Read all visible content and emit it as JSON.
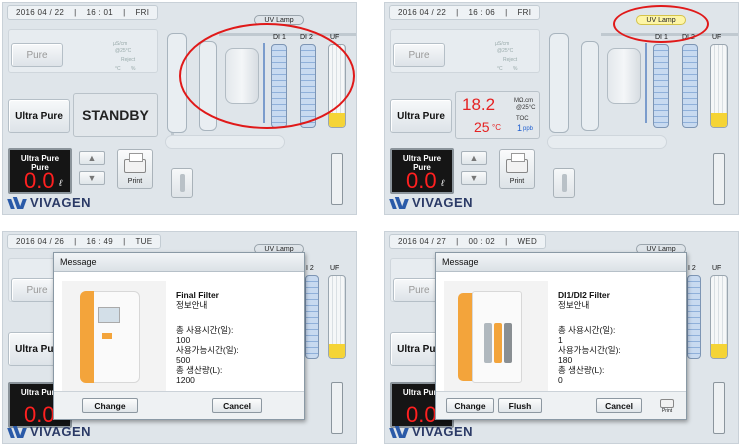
{
  "screens": [
    {
      "datebar": {
        "date": "2016  04 / 22",
        "time": "16 : 01",
        "day": "FRI"
      },
      "pure_label": "Pure",
      "pure_units": [
        "µS/cm",
        "@25°C",
        "Reject",
        "°C",
        "%"
      ],
      "ultra_pure_label": "Ultra Pure",
      "status_text": "STANDBY",
      "counter": {
        "label1": "Ultra Pure",
        "label2": "Pure",
        "value": "0.0",
        "unit": "ℓ"
      },
      "print_label": "Print",
      "uv_lamp_label": "UV Lamp",
      "columns": {
        "di1": "DI 1",
        "di2": "DI 2",
        "uf": "UF"
      },
      "uv_lamp_on": false,
      "logo": "VIVAGEN"
    },
    {
      "datebar": {
        "date": "2016  04 / 22",
        "time": "16 : 06",
        "day": "FRI"
      },
      "pure_label": "Pure",
      "pure_units": [
        "µS/cm",
        "@25°C",
        "Reject",
        "°C",
        "%"
      ],
      "ultra_pure_label": "Ultra Pure",
      "reading": {
        "resistivity": "18.2",
        "resistivity_unit_top": "MΩ.cm",
        "resistivity_unit_bottom": "@25°C",
        "temperature": "25",
        "temperature_unit": "°C",
        "toc_label": "TOC",
        "toc_value": "1",
        "toc_unit": "ppb"
      },
      "counter": {
        "label1": "Ultra Pure",
        "label2": "Pure",
        "value": "0.0",
        "unit": "ℓ"
      },
      "print_label": "Print",
      "uv_lamp_label": "UV Lamp",
      "columns": {
        "di1": "DI 1",
        "di2": "DI 2",
        "uf": "UF"
      },
      "uv_lamp_on": true,
      "logo": "VIVAGEN"
    },
    {
      "datebar": {
        "date": "2016  04 / 26",
        "time": "16 : 49",
        "day": "TUE"
      },
      "pure_label": "Pure",
      "ultra_pure_label": "Ultra Pure",
      "counter": {
        "label1": "Ultra Pure",
        "value": "0.0"
      },
      "uv_lamp_label": "UV Lamp",
      "columns": {
        "di2": "I 2",
        "uf": "UF"
      },
      "logo": "VIVAGEN",
      "dialog": {
        "title": "Message",
        "filter_name": "Final Filter",
        "info_label": "정보안내",
        "total_use_label": "총 사용시간(일):",
        "total_use_value": "100",
        "available_label": "사용가능시간(일):",
        "available_value": "500",
        "production_label": "총 생산량(L):",
        "production_value": "1200",
        "buttons": [
          "Change",
          "Cancel"
        ]
      }
    },
    {
      "datebar": {
        "date": "2016  04 / 27",
        "time": "00 : 02",
        "day": "WED"
      },
      "pure_label": "Pure",
      "ultra_pure_label": "Ultra Pure",
      "counter": {
        "label1": "Ultra Pure",
        "value": "0.0"
      },
      "uv_lamp_label": "UV Lamp",
      "columns": {
        "di2": "I 2",
        "uf": "UF"
      },
      "logo": "VIVAGEN",
      "dialog": {
        "title": "Message",
        "filter_name": "DI1/DI2 Filter",
        "info_label": "정보안내",
        "total_use_label": "총 사용시간(일):",
        "total_use_value": "1",
        "available_label": "사용가능시간(일):",
        "available_value": "180",
        "production_label": "총 생산량(L):",
        "production_value": "0",
        "buttons": [
          "Change",
          "Flush",
          "Cancel",
          "Print"
        ]
      }
    }
  ],
  "colors": {
    "panel_bg": "#dfe5ea",
    "highlight_ellipse": "#e01919",
    "digit_red": "#ff2020",
    "logo_blue": "#2b3a66",
    "resin_blue": "#8fb0da",
    "uf_yellow": "#f5d436"
  }
}
